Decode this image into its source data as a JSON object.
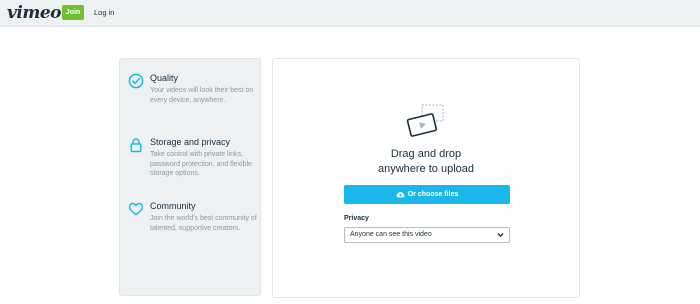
{
  "header": {
    "logo": "vimeo",
    "join_label": "Join",
    "login_label": "Log in"
  },
  "features": [
    {
      "icon": "check-circle-icon",
      "title": "Quality",
      "description": "Your videos will look their best on every device, anywhere."
    },
    {
      "icon": "lock-icon",
      "title": "Storage and privacy",
      "description": "Take control with private links, password protection, and flexible storage options."
    },
    {
      "icon": "heart-icon",
      "title": "Community",
      "description": "Join the world's best community of talented, supportive creators."
    }
  ],
  "uploader": {
    "drop_text": "Drag and drop anywhere to upload",
    "choose_label": "Or choose files",
    "privacy_label": "Privacy",
    "privacy_value": "Anyone can see this video"
  },
  "colors": {
    "accent": "#1ab7ea",
    "join": "#6ec12b",
    "text": "#1a2e3b",
    "muted": "#8a9aa4"
  }
}
